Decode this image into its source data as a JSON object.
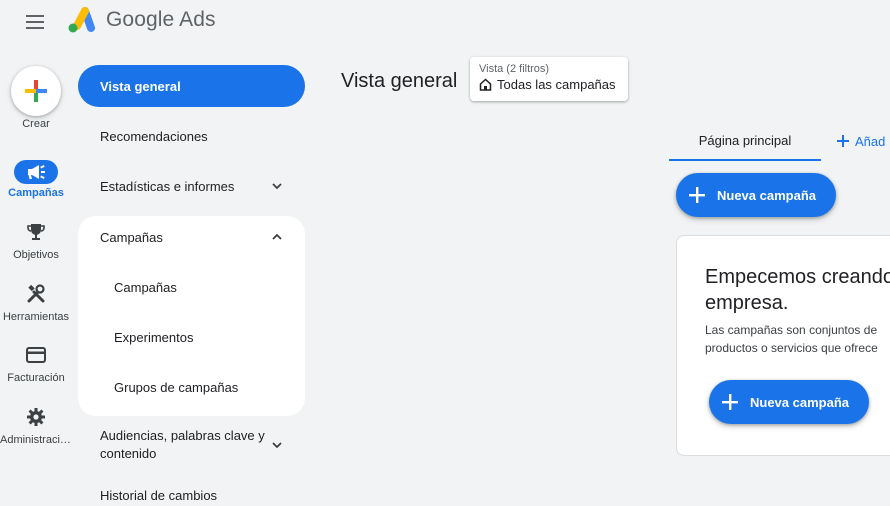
{
  "header": {
    "brand": "Google Ads",
    "menu_icon": "hamburger-menu-icon",
    "logo_icon": "google-ads-logo"
  },
  "rail": {
    "create_label": "Crear",
    "items": [
      {
        "label": "Campañas",
        "icon": "megaphone-icon",
        "active": true
      },
      {
        "label": "Objetivos",
        "icon": "trophy-icon",
        "active": false
      },
      {
        "label": "Herramientas",
        "icon": "tools-icon",
        "active": false
      },
      {
        "label": "Facturación",
        "icon": "credit-card-icon",
        "active": false
      },
      {
        "label": "Administración",
        "icon": "gear-icon",
        "active": false
      }
    ]
  },
  "nav": {
    "overview": "Vista general",
    "recommendations": "Recomendaciones",
    "stats": "Estadísticas e informes",
    "campaigns": "Campañas",
    "sub": [
      "Campañas",
      "Experimentos",
      "Grupos de campañas"
    ],
    "audiences": "Audiencias, palabras clave y contenido",
    "history": "Historial de cambios"
  },
  "main": {
    "title": "Vista general",
    "view": {
      "label": "Vista (2 filtros)",
      "value": "Todas las campañas",
      "icon": "home-icon"
    },
    "tabs": {
      "home": "Página principal",
      "add": "Añad"
    },
    "new_campaign": "Nueva campaña",
    "card": {
      "title": "Empecemos creando\nempresa.",
      "text": "Las campañas son conjuntos de\nproductos o servicios que ofrece",
      "button": "Nueva campaña"
    }
  },
  "colors": {
    "accent": "#1a73e8",
    "background": "#f1f3f4",
    "surface": "#ffffff"
  }
}
